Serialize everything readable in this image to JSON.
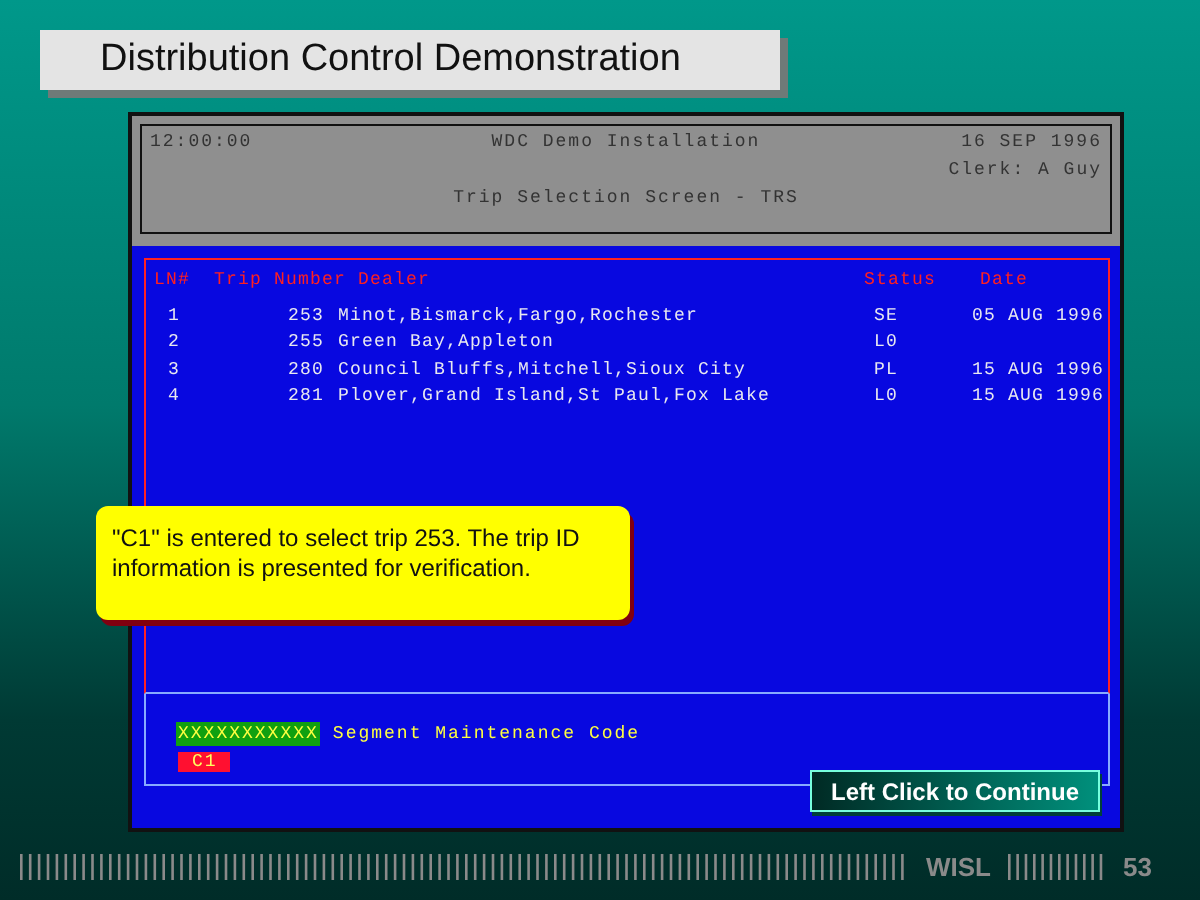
{
  "slide_title": "Distribution Control Demonstration",
  "terminal": {
    "header": {
      "time": "12:00:00",
      "installation": "WDC Demo Installation",
      "date": "16 SEP 1996",
      "clerk": "Clerk: A Guy",
      "screen_title": "Trip Selection Screen - TRS"
    },
    "table": {
      "columns": [
        "LN#",
        "Trip Number",
        "Dealer",
        "Status",
        "Date"
      ],
      "rows": [
        {
          "ln": "1",
          "trip": "253",
          "dealer": "Minot,Bismarck,Fargo,Rochester",
          "status": "SE",
          "date": "05 AUG 1996"
        },
        {
          "ln": "2",
          "trip": "255",
          "dealer": "Green Bay,Appleton",
          "status": "L0"
        },
        {
          "ln": "3",
          "trip": "280",
          "dealer": "Council Bluffs,Mitchell,Sioux City",
          "status": "PL",
          "date": "15 AUG 1996"
        },
        {
          "ln": "4",
          "trip": "281",
          "dealer": "Plover,Grand Island,St Paul,Fox Lake",
          "status": "L0",
          "date": "15 AUG 1996"
        }
      ]
    },
    "segment": {
      "mask": "XXXXXXXXXXX",
      "label": "Segment Maintenance Code",
      "code": "C1"
    }
  },
  "callout": "\"C1\" is entered to select trip 253. The trip ID information is presented for verification.",
  "continue_button": "Left Click to Continue",
  "footer": {
    "org": "WISL",
    "page": "53"
  }
}
